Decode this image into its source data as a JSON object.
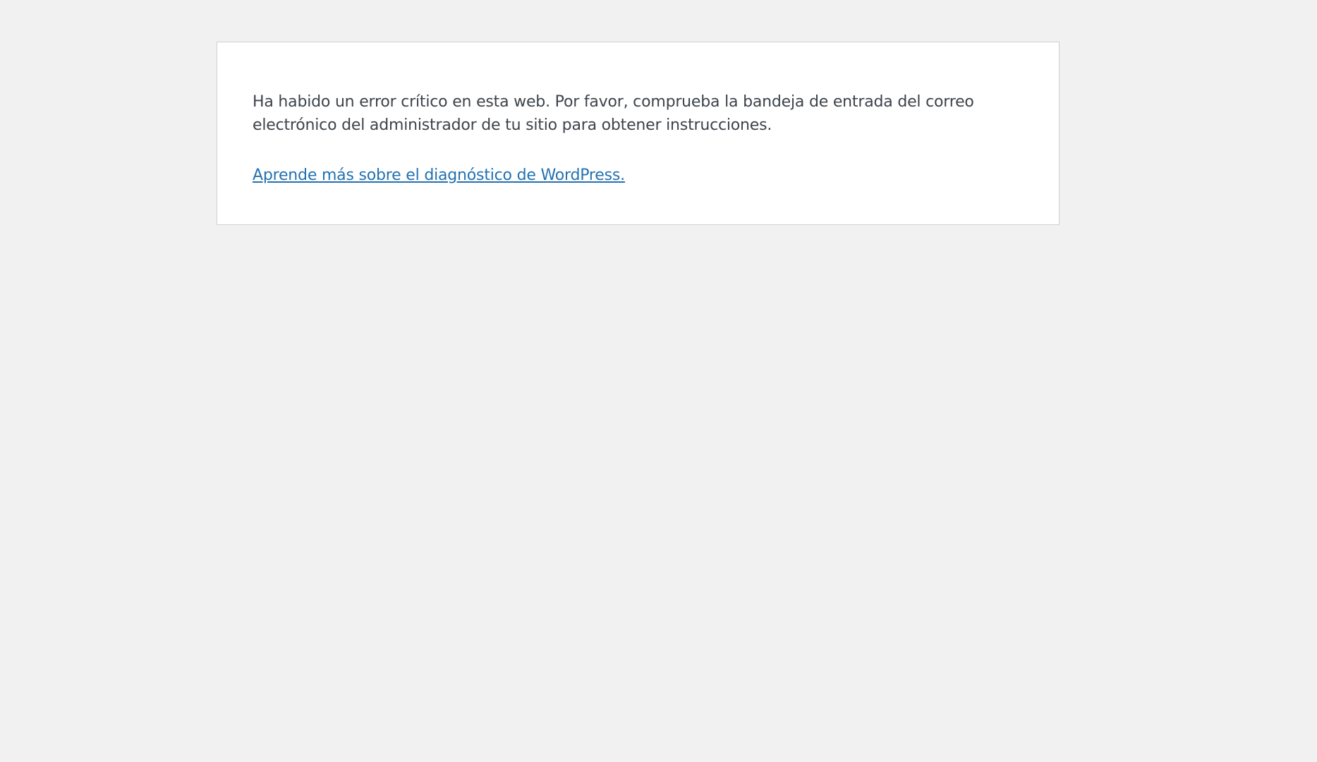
{
  "error": {
    "message": "Ha habido un error crítico en esta web. Por favor, comprueba la bandeja de entrada del correo electrónico del administrador de tu sitio para obtener instrucciones.",
    "link_label": "Aprende más sobre el diagnóstico de WordPress."
  },
  "colors": {
    "background": "#f1f1f1",
    "panel": "#ffffff",
    "text": "#3c434a",
    "link": "#2271b1"
  }
}
